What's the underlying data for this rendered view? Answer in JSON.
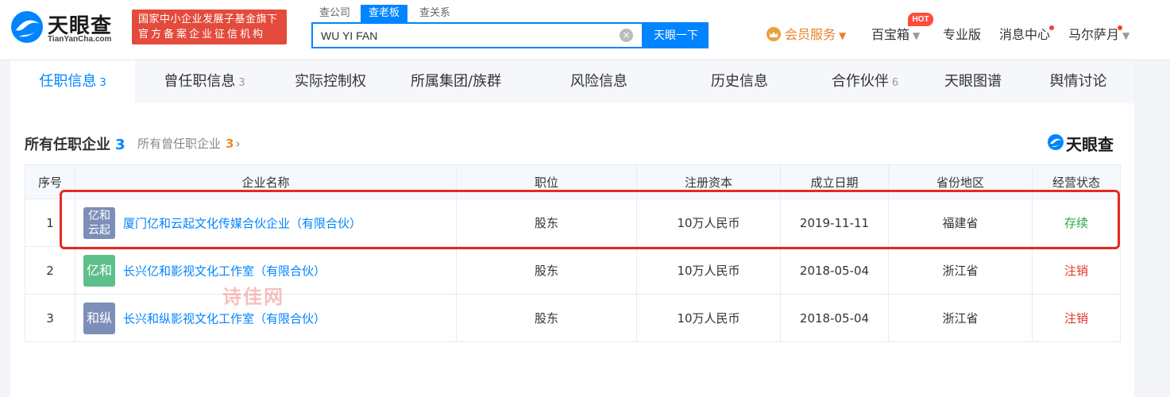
{
  "header": {
    "logo_text": "天眼查",
    "logo_sub": "TianYanCha.com",
    "org_badge_line1": "国家中小企业发展子基金旗下",
    "org_badge_line2": "官方备案企业征信机构",
    "search_tabs": [
      "查公司",
      "查老板",
      "查关系"
    ],
    "search_value": "WU YI FAN",
    "clear_icon": "×",
    "search_button": "天眼一下",
    "nav": {
      "vip": "会员服务",
      "treasure": "百宝箱",
      "hot": "HOT",
      "pro": "专业版",
      "messages": "消息中心",
      "user": "马尔萨月"
    }
  },
  "tabs": [
    {
      "label": "任职信息",
      "count": "3"
    },
    {
      "label": "曾任职信息",
      "count": "3"
    },
    {
      "label": "实际控制权",
      "count": ""
    },
    {
      "label": "所属集团/族群",
      "count": ""
    },
    {
      "label": "风险信息",
      "count": ""
    },
    {
      "label": "历史信息",
      "count": ""
    },
    {
      "label": "合作伙伴",
      "count": "6"
    },
    {
      "label": "天眼图谱",
      "count": ""
    },
    {
      "label": "舆情讨论",
      "count": ""
    }
  ],
  "section": {
    "title": "所有任职企业",
    "count": "3",
    "sub": "所有曾任职企业",
    "sub_count": "3",
    "arrow": "›",
    "brand": "天眼查"
  },
  "table": {
    "headers": [
      "序号",
      "企业名称",
      "职位",
      "注册资本",
      "成立日期",
      "省份地区",
      "经营状态"
    ],
    "rows": [
      {
        "idx": "1",
        "logo_line1": "亿和",
        "logo_line2": "云起",
        "logo_color": "#7d8fb8",
        "name": "厦门亿和云起文化传媒合伙企业（有限合伙）",
        "position": "股东",
        "capital": "10万人民币",
        "date": "2019-11-11",
        "region": "福建省",
        "status": "存续"
      },
      {
        "idx": "2",
        "logo_line1": "亿和",
        "logo_line2": "",
        "logo_color": "#5fbf8a",
        "name": "长兴亿和影视文化工作室（有限合伙）",
        "position": "股东",
        "capital": "10万人民币",
        "date": "2018-05-04",
        "region": "浙江省",
        "status": "注销"
      },
      {
        "idx": "3",
        "logo_line1": "和纵",
        "logo_line2": "",
        "logo_color": "#7d8fb8",
        "name": "长兴和纵影视文化工作室（有限合伙）",
        "position": "股东",
        "capital": "10万人民币",
        "date": "2018-05-04",
        "region": "浙江省",
        "status": "注销"
      }
    ]
  },
  "watermark": "诗佳网",
  "colors": {
    "accent": "#0084ff",
    "active_status": "#28a745",
    "cancelled_status": "#e3342f",
    "highlight": "#e52a1f",
    "badge": "#e34b3c"
  }
}
